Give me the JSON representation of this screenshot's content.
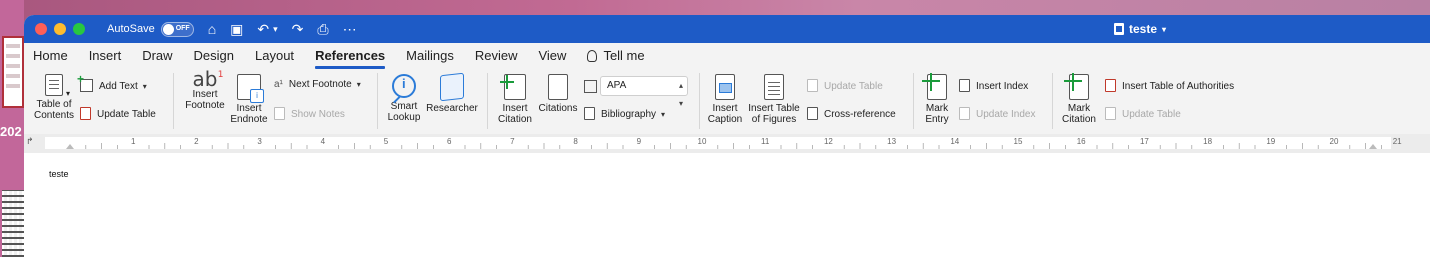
{
  "desktop": {
    "year_fragment": "202"
  },
  "titlebar": {
    "autosave_label": "AutoSave",
    "autosave_state": "OFF",
    "document_title": "teste",
    "icons": [
      "home-icon",
      "save-icon",
      "undo-icon",
      "redo-icon",
      "print-icon",
      "more-icon"
    ]
  },
  "tabs": [
    {
      "label": "Home"
    },
    {
      "label": "Insert"
    },
    {
      "label": "Draw"
    },
    {
      "label": "Design"
    },
    {
      "label": "Layout"
    },
    {
      "label": "References",
      "active": true
    },
    {
      "label": "Mailings"
    },
    {
      "label": "Review"
    },
    {
      "label": "View"
    },
    {
      "label": "Tell me"
    }
  ],
  "ribbon": {
    "toc": {
      "label_1": "Table of",
      "label_2": "Contents",
      "add_text": "Add Text",
      "update_table": "Update Table"
    },
    "footnotes": {
      "insert_footnote_1": "Insert",
      "insert_footnote_2": "Footnote",
      "insert_endnote_1": "Insert",
      "insert_endnote_2": "Endnote",
      "next_footnote": "Next Footnote",
      "show_notes": "Show Notes"
    },
    "research": {
      "smart_lookup_1": "Smart",
      "smart_lookup_2": "Lookup",
      "researcher": "Researcher"
    },
    "citations": {
      "insert_citation_1": "Insert",
      "insert_citation_2": "Citation",
      "citations": "Citations",
      "style_value": "APA",
      "bibliography": "Bibliography"
    },
    "captions": {
      "insert_caption_1": "Insert",
      "insert_caption_2": "Caption",
      "insert_tof_1": "Insert Table",
      "insert_tof_2": "of Figures",
      "update_table": "Update Table",
      "cross_reference": "Cross-reference"
    },
    "index": {
      "mark_entry_1": "Mark",
      "mark_entry_2": "Entry",
      "insert_index": "Insert Index",
      "update_index": "Update Index"
    },
    "authorities": {
      "mark_citation_1": "Mark",
      "mark_citation_2": "Citation",
      "insert_toa": "Insert Table of Authorities",
      "update_table": "Update Table"
    }
  },
  "ruler": {
    "numbers": [
      "1",
      "2",
      "3",
      "4",
      "5",
      "6",
      "7",
      "8",
      "9",
      "10",
      "11",
      "12",
      "13",
      "14",
      "15",
      "16",
      "17",
      "18",
      "19",
      "20",
      "21"
    ]
  },
  "document": {
    "body_text": "teste"
  },
  "colors": {
    "titlebar": "#1e5bc6",
    "active_tab_underline": "#1e5bc6",
    "ribbon_bg": "#f3f3f3"
  }
}
